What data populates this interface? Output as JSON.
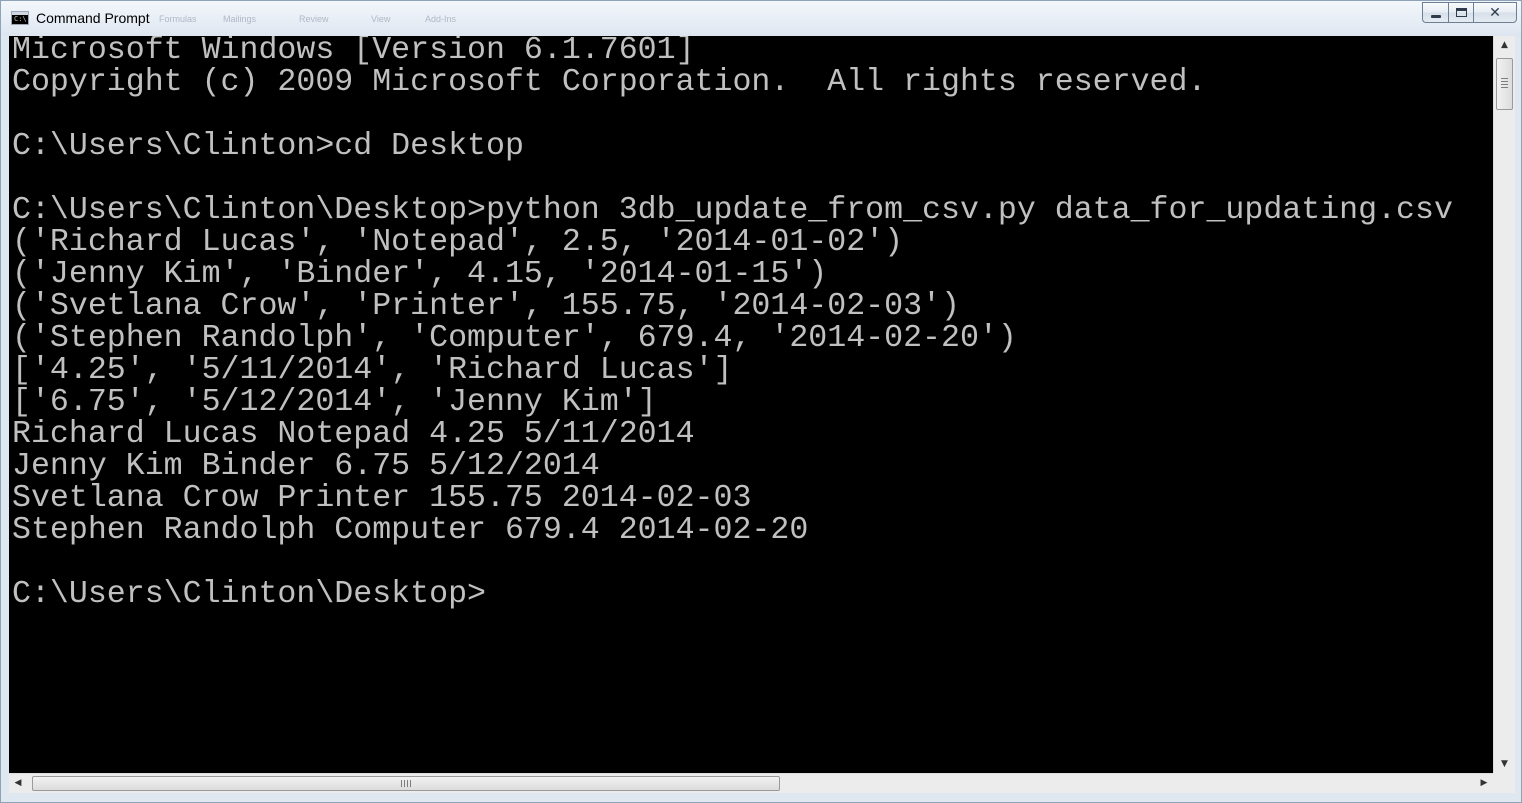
{
  "window": {
    "title": "Command Prompt",
    "icon": "cmd-icon",
    "ghost_tabs": [
      "Formulas",
      "Mailings",
      "Review",
      "View",
      "Add-Ins"
    ]
  },
  "controls": {
    "minimize_icon": "minimize-icon",
    "maximize_icon": "maximize-icon",
    "close_icon": "close-icon",
    "close_glyph": "✕"
  },
  "console": {
    "background": "#000000",
    "foreground": "#c0c0c0",
    "lines": [
      "Microsoft Windows [Version 6.1.7601]",
      "Copyright (c) 2009 Microsoft Corporation.  All rights reserved.",
      "",
      "C:\\Users\\Clinton>cd Desktop",
      "",
      "C:\\Users\\Clinton\\Desktop>python 3db_update_from_csv.py data_for_updating.csv",
      "('Richard Lucas', 'Notepad', 2.5, '2014-01-02')",
      "('Jenny Kim', 'Binder', 4.15, '2014-01-15')",
      "('Svetlana Crow', 'Printer', 155.75, '2014-02-03')",
      "('Stephen Randolph', 'Computer', 679.4, '2014-02-20')",
      "['4.25', '5/11/2014', 'Richard Lucas']",
      "['6.75', '5/12/2014', 'Jenny Kim']",
      "Richard Lucas Notepad 4.25 5/11/2014",
      "Jenny Kim Binder 6.75 5/12/2014",
      "Svetlana Crow Printer 155.75 2014-02-03",
      "Stephen Randolph Computer 679.4 2014-02-20",
      "",
      "C:\\Users\\Clinton\\Desktop>"
    ]
  },
  "scrollbars": {
    "up_glyph": "▲",
    "down_glyph": "▼",
    "left_glyph": "◀",
    "right_glyph": "▶"
  }
}
